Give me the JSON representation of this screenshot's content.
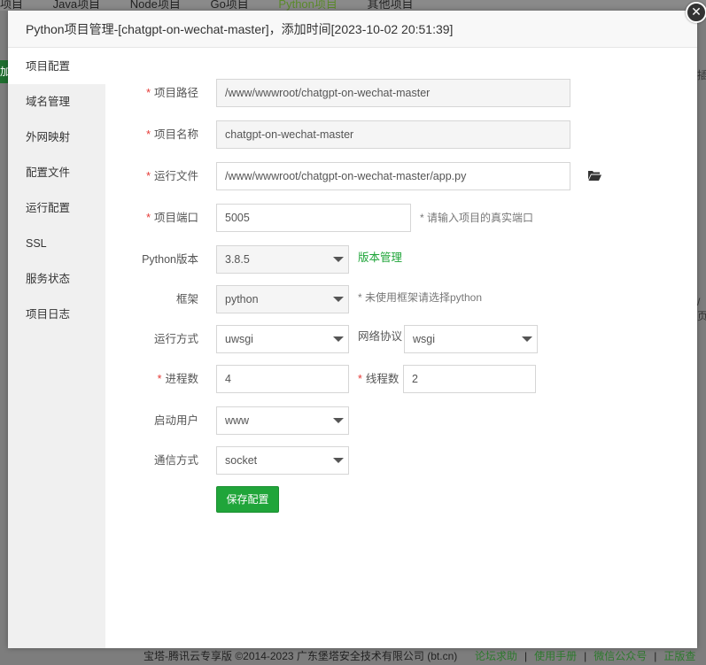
{
  "background": {
    "tabs": [
      "项目",
      "Java项目",
      "Node项目",
      "Go项目",
      "Python项目",
      "其他项目"
    ],
    "left_button": "加",
    "right_top": "插",
    "right_mid": "/页"
  },
  "modal": {
    "title": "Python项目管理-[chatgpt-on-wechat-master]，添加时间[2023-10-02 20:51:39]",
    "close_label": "✕"
  },
  "sidebar": {
    "items": [
      "项目配置",
      "域名管理",
      "外网映射",
      "配置文件",
      "运行配置",
      "SSL",
      "服务状态",
      "项目日志"
    ]
  },
  "form": {
    "path": {
      "label": "项目路径",
      "value": "/www/wwwroot/chatgpt-on-wechat-master"
    },
    "name": {
      "label": "项目名称",
      "value": "chatgpt-on-wechat-master"
    },
    "run_file": {
      "label": "运行文件",
      "value": "/www/wwwroot/chatgpt-on-wechat-master/app.py"
    },
    "port": {
      "label": "项目端口",
      "value": "5005",
      "hint": "* 请输入项目的真实端口"
    },
    "python_version": {
      "label": "Python版本",
      "value": "3.8.5",
      "link": "版本管理"
    },
    "framework": {
      "label": "框架",
      "value": "python",
      "hint": "* 未使用框架请选择python"
    },
    "run_mode": {
      "label": "运行方式",
      "value": "uwsgi",
      "protocol_label": "网络协议",
      "protocol_value": "wsgi"
    },
    "processes": {
      "label": "进程数",
      "value": "4",
      "threads_label": "线程数",
      "threads_value": "2"
    },
    "user": {
      "label": "启动用户",
      "value": "www"
    },
    "comm": {
      "label": "通信方式",
      "value": "socket"
    },
    "save_label": "保存配置"
  },
  "footer": {
    "copyright": "宝塔-腾讯云专享版 ©2014-2023 广东堡塔安全技术有限公司 (bt.cn)",
    "links": [
      "论坛求助",
      "使用手册",
      "微信公众号",
      "正版查"
    ]
  },
  "colors": {
    "accent": "#20a53a",
    "required": "#e53935"
  }
}
